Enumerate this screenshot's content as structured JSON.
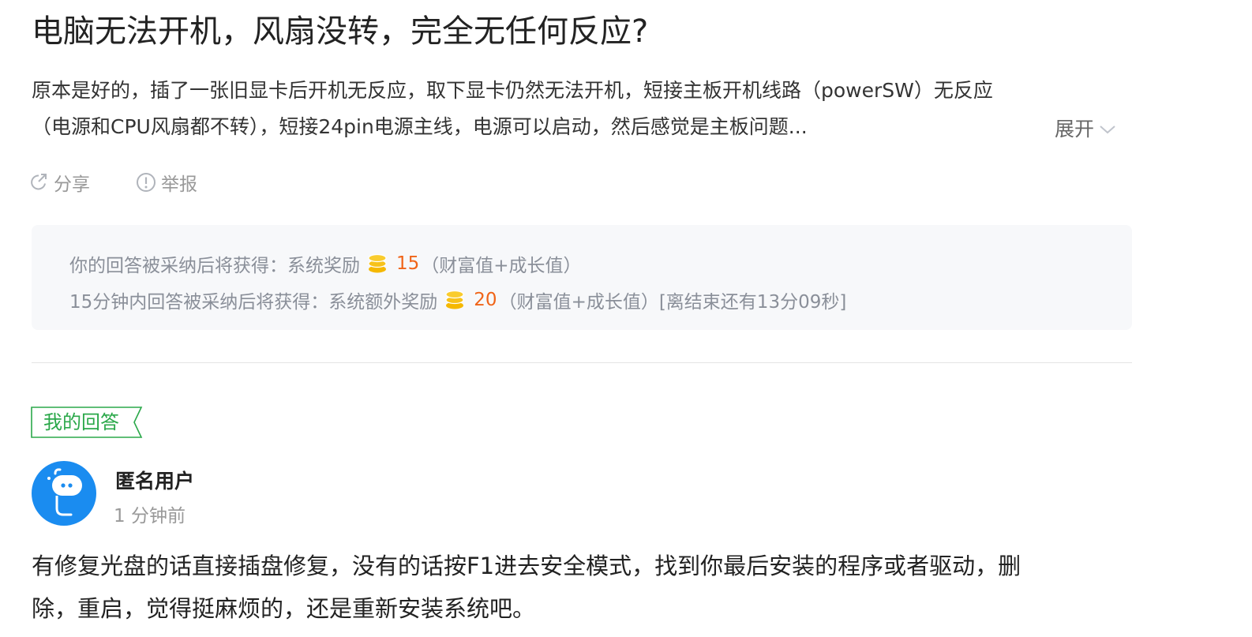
{
  "question": {
    "title": "电脑无法开机，风扇没转，完全无任何反应?",
    "description_lines": [
      "原本是好的，插了一张旧显卡后开机无反应，取下显卡仍然无法开机，短接主板开机线路（powerSW）无反应",
      "（电源和CPU风扇都不转），短接24pin电源主线，电源可以启动，然后感觉是主板问题..."
    ],
    "expand_label": "展开"
  },
  "actions": {
    "share_label": "分享",
    "report_label": "举报"
  },
  "reward": {
    "line1_prefix": "你的回答被采纳后将获得：系统奖励",
    "line1_value": "15",
    "line1_suffix": "（财富值+成长值）",
    "line2_prefix": "15分钟内回答被采纳后将获得：系统额外奖励",
    "line2_value": "20",
    "line2_suffix": "（财富值+成长值）[离结束还有13分09秒]"
  },
  "my_answer": {
    "tag_label": "我的回答",
    "user_name": "匿名用户",
    "time": "1 分钟前",
    "body_lines": [
      "有修复光盘的话直接插盘修复，没有的话按F1进去安全模式，找到你最后安装的程序或者驱动，删",
      "除，重启，觉得挺麻烦的，还是重新安装系统吧。"
    ]
  },
  "colors": {
    "accent_green": "#2ba84a",
    "reward_orange": "#f06418",
    "avatar_blue": "#1a8cf0",
    "coin_gold": "#f5b800"
  },
  "icons": {
    "share": "share-icon",
    "report": "report-icon",
    "coin": "coin-icon",
    "expand": "chevron-down-icon",
    "avatar": "anonymous-avatar-icon"
  }
}
